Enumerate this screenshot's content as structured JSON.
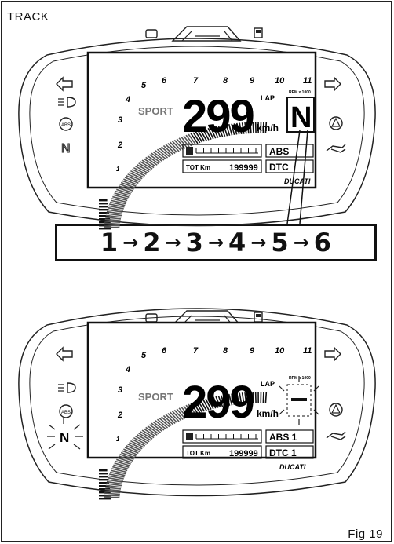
{
  "section_label": "TRACK",
  "figure_label": "Fig 19",
  "panel_top": {
    "mode": "SPORT",
    "speed": "299",
    "speed_unit": "km/h",
    "lap": "LAP",
    "rpm_label": "RPM x 1000",
    "gear": "N",
    "tot_label": "TOT Km",
    "odometer": "199999",
    "abs": "ABS",
    "dtc": "DTC",
    "brand": "DUCATI",
    "rpm_scale": [
      "1",
      "2",
      "3",
      "4",
      "5",
      "6",
      "7",
      "8",
      "9",
      "10",
      "11"
    ]
  },
  "panel_bottom": {
    "mode": "SPORT",
    "speed": "299",
    "speed_unit": "km/h",
    "lap": "LAP",
    "rpm_label": "RPM x 1000",
    "gear": "–",
    "tot_label": "TOT Km",
    "odometer": "199999",
    "abs": "ABS 1",
    "dtc": "DTC 1",
    "brand": "DUCATI",
    "neutral_indicator": "N",
    "rpm_scale": [
      "1",
      "2",
      "3",
      "4",
      "5",
      "6",
      "7",
      "8",
      "9",
      "10",
      "11"
    ]
  },
  "sequence": [
    "1",
    "2",
    "3",
    "4",
    "5",
    "6"
  ],
  "icons": {
    "left": [
      "turn-left-icon",
      "headlight-icon",
      "abs-icon",
      "neutral-icon"
    ],
    "right": [
      "turn-right-icon",
      "warning-icon",
      "oil-icon"
    ],
    "top": [
      "engine-icon",
      "highbeam-icon",
      "fuel-icon"
    ]
  }
}
